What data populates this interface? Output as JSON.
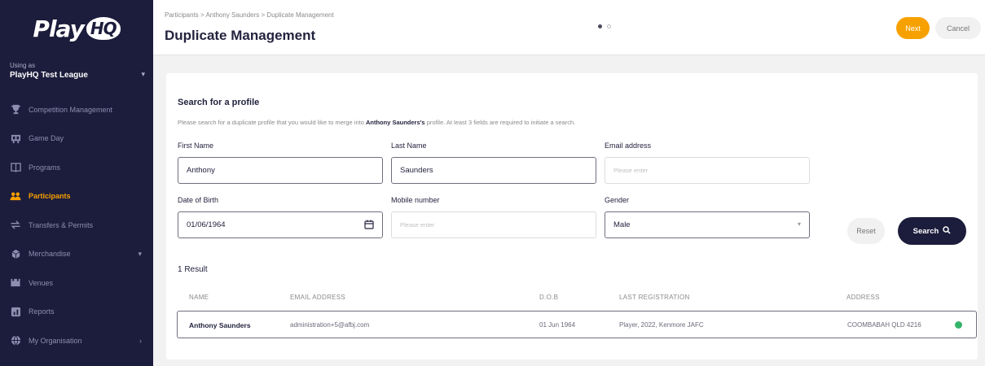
{
  "sidebar": {
    "logo_text": "Play",
    "logo_badge": "HQ",
    "org_caption": "Using as",
    "org_name": "PlayHQ Test League",
    "items": [
      {
        "label": "Competition Management",
        "icon": "trophy-icon",
        "active": false,
        "chevron": false
      },
      {
        "label": "Game Day",
        "icon": "scoreboard-icon",
        "active": false,
        "chevron": false
      },
      {
        "label": "Programs",
        "icon": "book-icon",
        "active": false,
        "chevron": false
      },
      {
        "label": "Participants",
        "icon": "participants-icon",
        "active": true,
        "chevron": false
      },
      {
        "label": "Transfers & Permits",
        "icon": "transfer-icon",
        "active": false,
        "chevron": false
      },
      {
        "label": "Merchandise",
        "icon": "merchandise-icon",
        "active": false,
        "chevron": true
      },
      {
        "label": "Venues",
        "icon": "venue-icon",
        "active": false,
        "chevron": false
      },
      {
        "label": "Reports",
        "icon": "reports-icon",
        "active": false,
        "chevron": false
      },
      {
        "label": "My Organisation",
        "icon": "globe-icon",
        "active": false,
        "chevron": true
      }
    ]
  },
  "header": {
    "breadcrumb": "Participants > Anthony Saunders > Duplicate Management",
    "title": "Duplicate Management",
    "next_label": "Next",
    "cancel_label": "Cancel",
    "step": 1,
    "total_steps": 2
  },
  "search": {
    "heading": "Search for a profile",
    "desc_prefix": "Please search for a duplicate profile that you would like to merge into ",
    "desc_name": "Anthony Saunders's",
    "desc_suffix": " profile. At least 3 fields are required to initiate a search.",
    "first_name_label": "First Name",
    "first_name_value": "Anthony",
    "last_name_label": "Last Name",
    "last_name_value": "Saunders",
    "email_label": "Email address",
    "email_placeholder": "Please enter",
    "dob_label": "Date of Birth",
    "dob_value": "01/06/1964",
    "mobile_label": "Mobile number",
    "mobile_placeholder": "Please enter",
    "gender_label": "Gender",
    "gender_value": "Male",
    "reset_label": "Reset",
    "search_label": "Search"
  },
  "results": {
    "count_label": "1 Result",
    "columns": [
      "NAME",
      "EMAIL ADDRESS",
      "D.O.B",
      "LAST REGISTRATION",
      "ADDRESS"
    ],
    "rows": [
      {
        "name": "Anthony Saunders",
        "email": "administration+5@afbj.com",
        "dob": "01 Jun 1964",
        "last_registration": "Player, 2022, Kenmore JAFC",
        "address": "COOMBABAH QLD 4216",
        "status_color": "#34b36b"
      }
    ]
  },
  "colors": {
    "sidebar_bg": "#1c1c3c",
    "accent": "#f7a100",
    "success": "#34b36b"
  }
}
